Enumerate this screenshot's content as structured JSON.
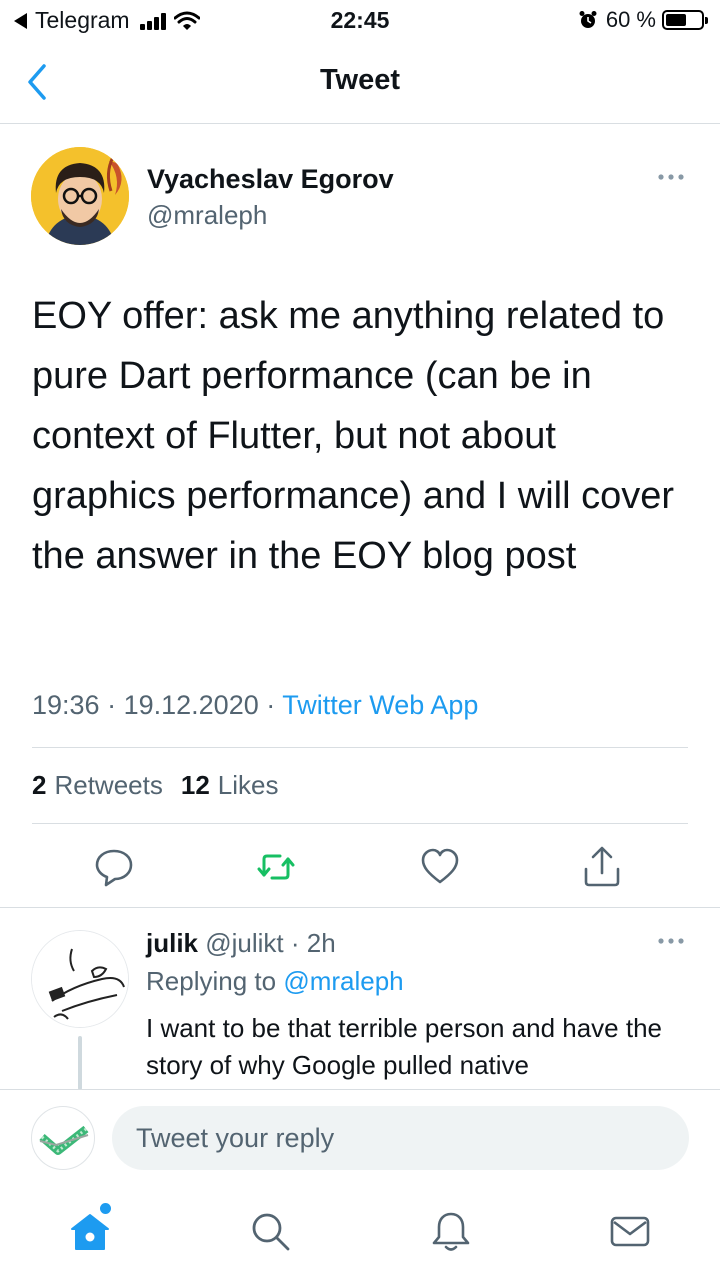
{
  "status_bar": {
    "back_app": "Telegram",
    "time": "22:45",
    "battery": "60 %",
    "battery_level": 0.6
  },
  "header": {
    "title": "Tweet"
  },
  "tweet": {
    "author_name": "Vyacheslav Egorov",
    "author_handle": "@mraleph",
    "text": "EOY offer: ask me anything related to pure Dart performance (can be in context of Flutter, but not about graphics performance) and I will cover the answer in the EOY blog post",
    "time": "19:36",
    "date": "19.12.2020",
    "source": "Twitter Web App",
    "retweets_count": "2",
    "retweets_label": "Retweets",
    "likes_count": "12",
    "likes_label": "Likes"
  },
  "actions": {
    "reply_icon": "speech-bubble-icon",
    "retweet_icon": "retweet-icon",
    "like_icon": "heart-icon",
    "share_icon": "share-icon",
    "retweet_color": "#17bf63"
  },
  "reply": {
    "name": "julik",
    "handle": "@julikt",
    "age": "2h",
    "replying_prefix": "Replying to",
    "replying_to": "@mraleph",
    "text": "I want to be that terrible person and have the story of why Google pulled native"
  },
  "composer": {
    "placeholder": "Tweet your reply"
  },
  "tabbar": {
    "items": [
      "home-icon",
      "search-icon",
      "notifications-icon",
      "messages-icon"
    ],
    "accent": "#1d9bf0"
  }
}
